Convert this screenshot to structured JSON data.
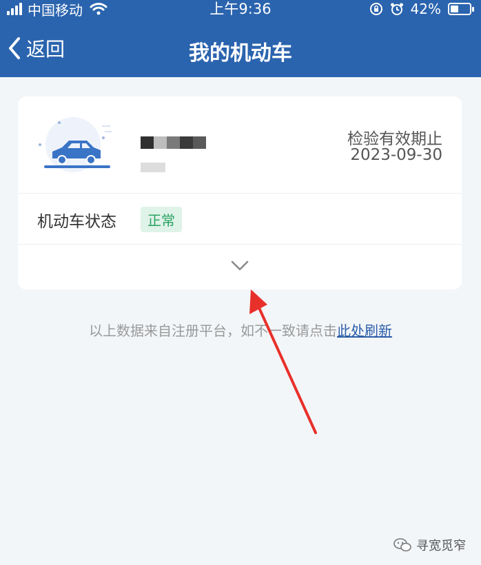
{
  "status_bar": {
    "carrier": "中国移动",
    "time": "上午9:36",
    "battery": "42%",
    "battery_level": 0.42
  },
  "nav": {
    "back_label": "返回",
    "title": "我的机动车"
  },
  "vehicle_card": {
    "inspection_label": "检验有效期止",
    "inspection_date": "2023-09-30",
    "status_label": "机动车状态",
    "status_value": "正常"
  },
  "footer_note": {
    "text": "以上数据来自注册平台，如不一致请点击",
    "link": "此处刷新"
  },
  "watermark": {
    "text": "寻宽觅窄"
  },
  "colors": {
    "header": "#2b64ae",
    "background": "#f3f6f9",
    "status_ok_bg": "#dff3e8",
    "status_ok_text": "#2aa162",
    "link": "#2b5da8",
    "annotation_arrow": "#e8302a"
  },
  "icons": {
    "back": "chevron-left-icon",
    "expand": "chevron-down-icon",
    "car": "car-icon",
    "wifi": "wifi-icon",
    "alarm": "alarm-icon",
    "lock_rotation": "rotation-lock-icon",
    "battery": "battery-icon",
    "wechat": "wechat-icon"
  }
}
